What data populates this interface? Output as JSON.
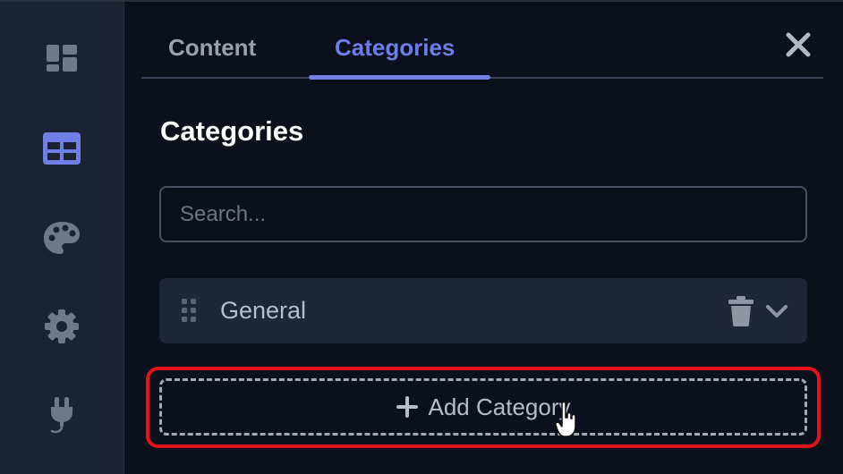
{
  "sidebar": {
    "items": [
      {
        "icon": "dashboard-icon",
        "active": false
      },
      {
        "icon": "table-icon",
        "active": true
      },
      {
        "icon": "palette-icon",
        "active": false
      },
      {
        "icon": "gear-icon",
        "active": false
      },
      {
        "icon": "plug-icon",
        "active": false
      }
    ]
  },
  "tabs": [
    {
      "label": "Content",
      "active": false
    },
    {
      "label": "Categories",
      "active": true
    }
  ],
  "panel": {
    "title": "Categories",
    "search_placeholder": "Search...",
    "categories": [
      {
        "label": "General"
      }
    ],
    "add_button_label": "Add Category"
  },
  "colors": {
    "accent": "#6c7ee8",
    "background": "#0c0f1c",
    "sidebar": "#1b2232",
    "highlight": "#e4121b"
  }
}
